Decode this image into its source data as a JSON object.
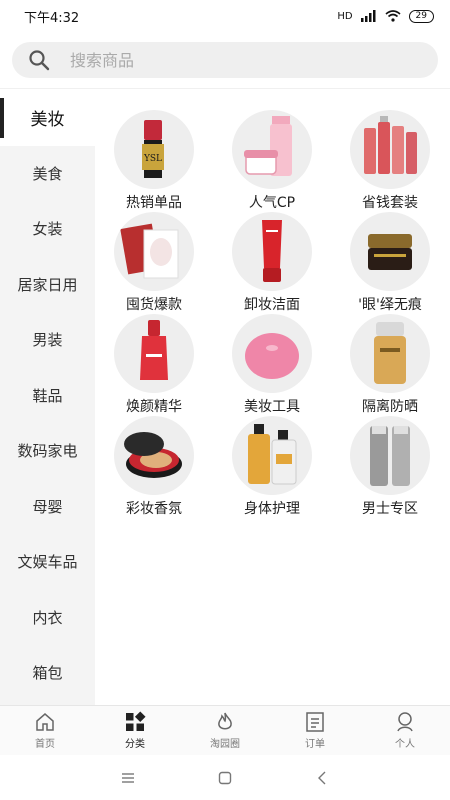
{
  "status": {
    "time": "下午4:32",
    "network": "HD",
    "battery": "29"
  },
  "search": {
    "placeholder": "搜索商品"
  },
  "sidebar": {
    "items": [
      {
        "label": "美妆",
        "active": true
      },
      {
        "label": "美食"
      },
      {
        "label": "女装"
      },
      {
        "label": "居家日用"
      },
      {
        "label": "男装"
      },
      {
        "label": "鞋品"
      },
      {
        "label": "数码家电"
      },
      {
        "label": "母婴"
      },
      {
        "label": "文娱车品"
      },
      {
        "label": "内衣"
      },
      {
        "label": "箱包"
      }
    ]
  },
  "categories": [
    {
      "label": "热销单品",
      "icon": "lipstick-product-image"
    },
    {
      "label": "人气CP",
      "icon": "toner-cream-set-image"
    },
    {
      "label": "省钱套装",
      "icon": "skincare-bottles-image"
    },
    {
      "label": "囤货爆款",
      "icon": "face-mask-image"
    },
    {
      "label": "卸妆洁面",
      "icon": "cleanser-tube-image"
    },
    {
      "label": "'眼'绎无痕",
      "icon": "eye-cream-jar-image"
    },
    {
      "label": "焕颜精华",
      "icon": "serum-bottle-image"
    },
    {
      "label": "美妆工具",
      "icon": "cleansing-brush-image"
    },
    {
      "label": "隔离防晒",
      "icon": "sunscreen-bottle-image"
    },
    {
      "label": "彩妆香氛",
      "icon": "cushion-compact-image"
    },
    {
      "label": "身体护理",
      "icon": "body-care-bottles-image"
    },
    {
      "label": "男士专区",
      "icon": "men-skincare-image"
    }
  ],
  "bottom_nav": [
    {
      "label": "首页",
      "icon": "home-icon"
    },
    {
      "label": "分类",
      "icon": "category-grid-icon",
      "active": true
    },
    {
      "label": "淘园圈",
      "icon": "flame-icon"
    },
    {
      "label": "订单",
      "icon": "order-list-icon"
    },
    {
      "label": "个人",
      "icon": "user-icon"
    }
  ],
  "colors": {
    "accent": "#222222",
    "sidebar_bg": "#f4f4f4",
    "thumb_bg": "#eeeeee"
  }
}
